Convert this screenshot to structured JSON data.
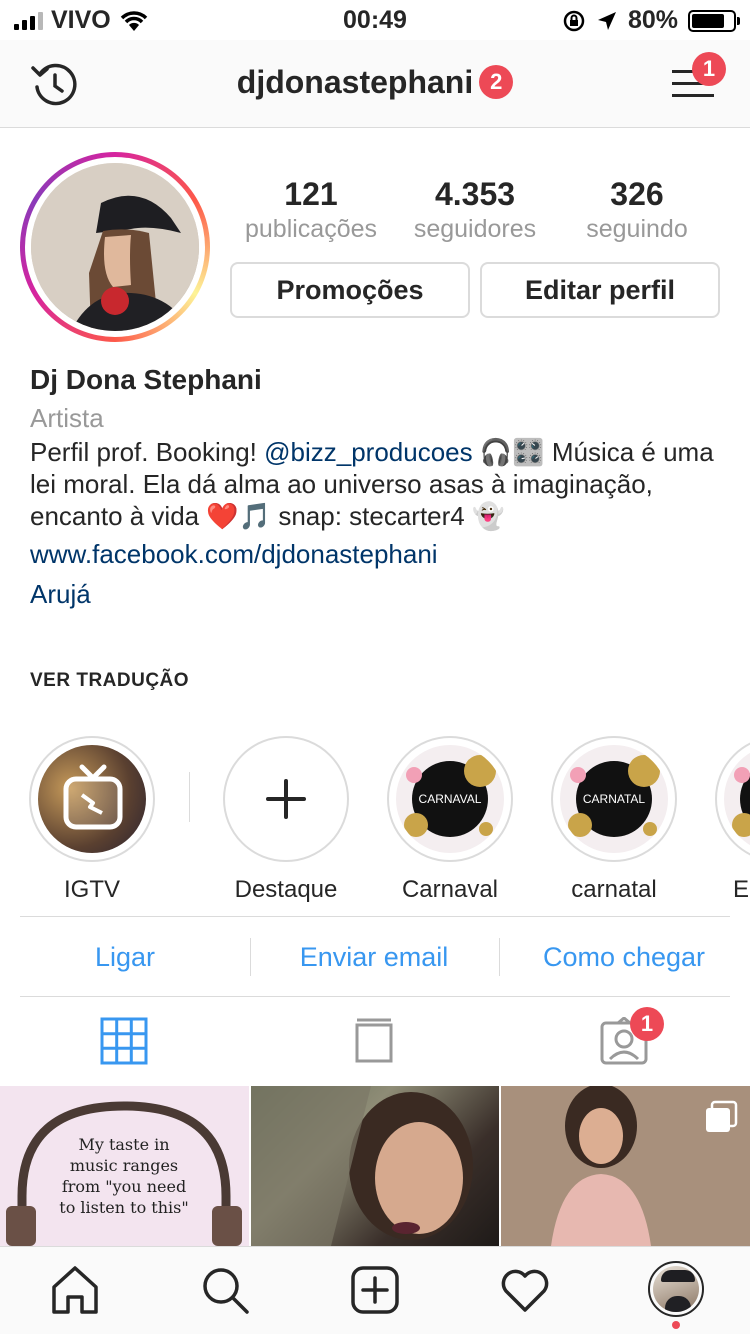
{
  "status_bar": {
    "carrier": "VIVO",
    "time": "00:49",
    "battery": "80%"
  },
  "header": {
    "username": "djdonastephani",
    "username_badge": "2",
    "menu_badge": "1"
  },
  "profile": {
    "stats": [
      {
        "value": "121",
        "label": "publicações"
      },
      {
        "value": "4.353",
        "label": "seguidores"
      },
      {
        "value": "326",
        "label": "seguindo"
      }
    ],
    "promo_button": "Promoções",
    "edit_button": "Editar perfil",
    "name": "Dj Dona Stephani",
    "category": "Artista",
    "bio_prefix": "Perfil prof. Booking! ",
    "bio_mention": "@bizz_producoes",
    "bio_rest": " 🎧🎛️ Música é uma lei moral. Ela dá alma ao universo asas à imaginação, encanto à vida ❤️🎵 snap: stecarter4 👻",
    "website": "www.facebook.com/djdonastephani",
    "location": "Arujá",
    "translate": "VER TRADUÇÃO"
  },
  "highlights": [
    {
      "label": "IGTV",
      "icon": "igtv-icon"
    },
    {
      "label": "Destaque",
      "icon": "plus-icon"
    },
    {
      "label": "Carnaval",
      "cover_text": "CARNAVAL"
    },
    {
      "label": "carnatal",
      "cover_text": "CARNATAL"
    },
    {
      "label": "Er"
    }
  ],
  "contact_actions": [
    "Ligar",
    "Enviar email",
    "Como chegar"
  ],
  "tabs": {
    "tagged_badge": "1"
  },
  "grid": {
    "post1_text": "My taste in music ranges from \"you need to listen to this\""
  },
  "colors": {
    "link_blue": "#3897f0",
    "bio_link": "#003569",
    "badge_red": "#ed4956",
    "tab_active": "#3897f0"
  }
}
